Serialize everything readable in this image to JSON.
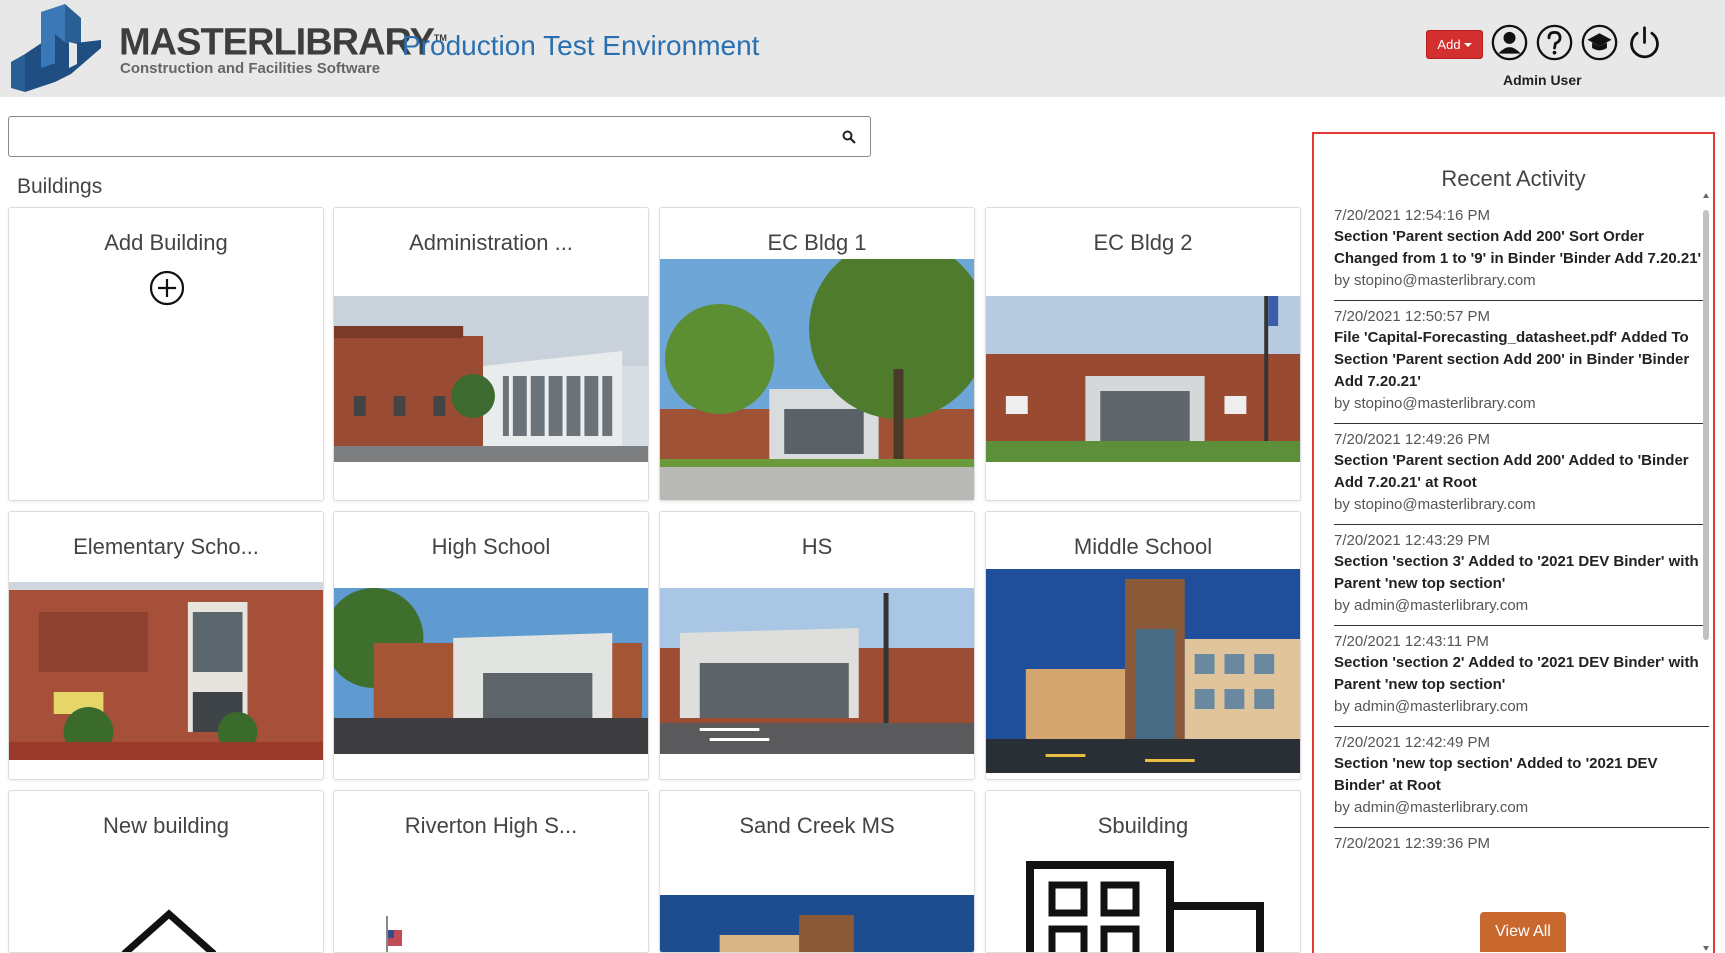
{
  "header": {
    "brand_name": "MASTERLIBRARY",
    "brand_tm": "TM",
    "brand_sub": "Construction and Facilities Software",
    "environment": "Production Test Environment",
    "add_label": "Add",
    "user_name": "Admin User",
    "icons": [
      "user-icon",
      "help-icon",
      "graduation-cap-icon",
      "power-icon"
    ]
  },
  "search": {
    "value": "",
    "placeholder": ""
  },
  "buildings": {
    "title": "Buildings",
    "add_label": "Add Building",
    "items": [
      {
        "name": "Administration ..."
      },
      {
        "name": "EC Bldg 1"
      },
      {
        "name": "EC Bldg 2"
      },
      {
        "name": "Elementary Scho..."
      },
      {
        "name": "High School"
      },
      {
        "name": "HS"
      },
      {
        "name": "Middle School"
      },
      {
        "name": "New building"
      },
      {
        "name": "Riverton High S..."
      },
      {
        "name": "Sand Creek MS"
      },
      {
        "name": "Sbuilding"
      }
    ]
  },
  "activity": {
    "title": "Recent Activity",
    "view_all": "View All",
    "items": [
      {
        "time": "7/20/2021 12:54:16 PM",
        "message": "Section 'Parent section Add 200' Sort Order Changed from 1 to '9' in Binder 'Binder Add 7.20.21'",
        "by": "by stopino@masterlibrary.com"
      },
      {
        "time": "7/20/2021 12:50:57 PM",
        "message": "File 'Capital-Forecasting_datasheet.pdf' Added To Section 'Parent section Add 200' in Binder 'Binder Add 7.20.21'",
        "by": "by stopino@masterlibrary.com"
      },
      {
        "time": "7/20/2021 12:49:26 PM",
        "message": "Section 'Parent section Add 200' Added to 'Binder Add 7.20.21' at Root",
        "by": "by stopino@masterlibrary.com"
      },
      {
        "time": "7/20/2021 12:43:29 PM",
        "message": "Section 'section 3' Added to '2021 DEV Binder' with Parent 'new top section'",
        "by": "by admin@masterlibrary.com"
      },
      {
        "time": "7/20/2021 12:43:11 PM",
        "message": "Section 'section 2' Added to '2021 DEV Binder' with Parent 'new top section'",
        "by": "by admin@masterlibrary.com"
      },
      {
        "time": "7/20/2021 12:42:49 PM",
        "message": "Section 'new top section' Added to '2021 DEV Binder' at Root",
        "by": "by admin@masterlibrary.com"
      },
      {
        "time": "7/20/2021 12:39:36 PM",
        "message": "",
        "by": ""
      }
    ]
  },
  "colors": {
    "header_bg": "#e8e8e8",
    "brand_blue": "#2a6fb0",
    "add_red": "#d32f2f",
    "panel_border": "#e53935",
    "view_all_orange": "#c8682e"
  }
}
